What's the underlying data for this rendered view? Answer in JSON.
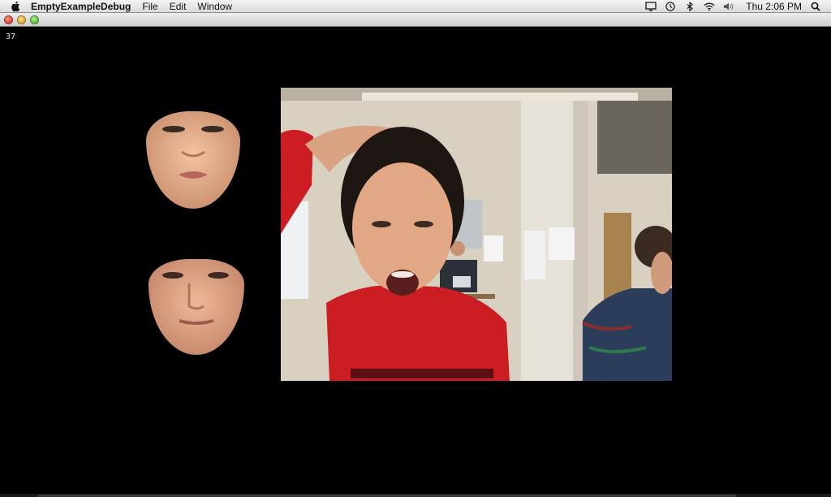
{
  "menubar": {
    "app_name": "EmptyExampleDebug",
    "menus": [
      "File",
      "Edit",
      "Window"
    ],
    "status_icons": [
      "display-icon",
      "time-machine-icon",
      "bluetooth-icon",
      "wifi-icon",
      "volume-icon",
      "spotlight-icon"
    ],
    "clock": "Thu 2:06 PM"
  },
  "window": {
    "traffic_lights": [
      "close",
      "minimize",
      "zoom"
    ]
  },
  "canvas": {
    "fps": "37",
    "background": "#000000"
  },
  "colors": {
    "hoodie_red": "#cc1d22",
    "skin": "#e9b18f",
    "wall": "#d9d2c2"
  }
}
